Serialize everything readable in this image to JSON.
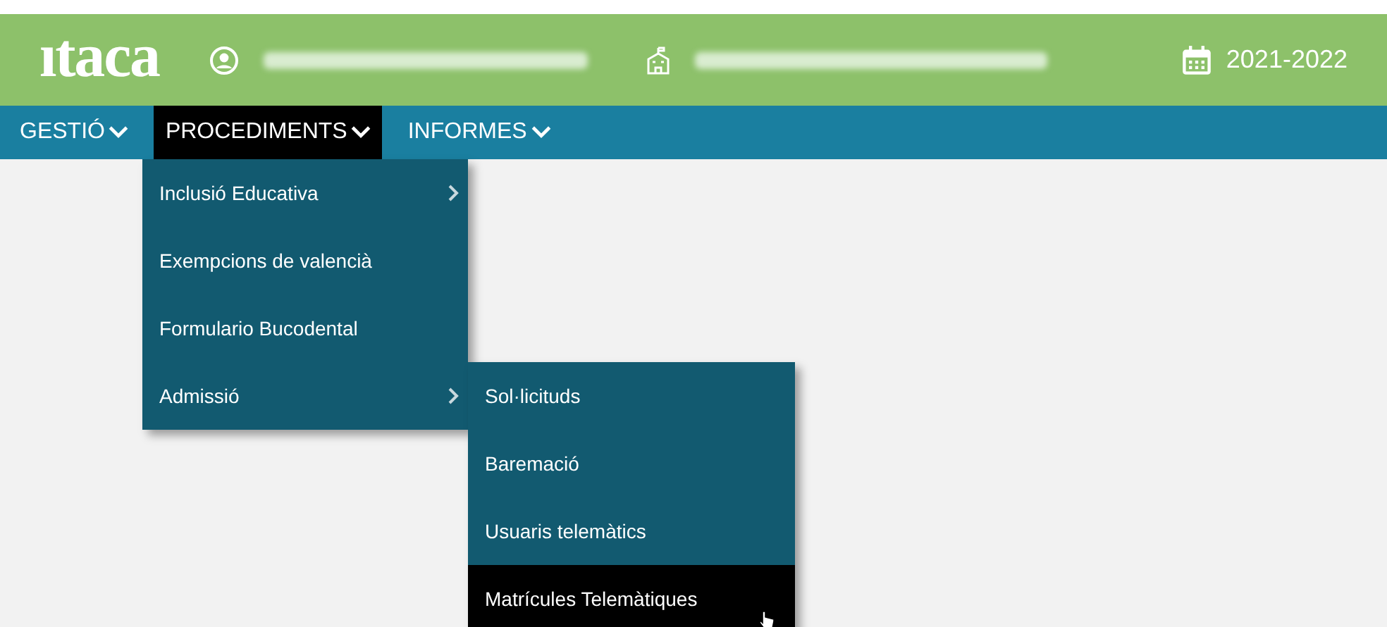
{
  "header": {
    "logo": "ıtaca",
    "year": "2021-2022"
  },
  "nav": [
    {
      "label": "GESTIÓ",
      "selected": false
    },
    {
      "label": "PROCEDIMENTS",
      "selected": true
    },
    {
      "label": "INFORMES",
      "selected": false
    }
  ],
  "menu": {
    "items": [
      {
        "label": "Inclusió Educativa",
        "has_submenu": true
      },
      {
        "label": "Exempcions de valencià",
        "has_submenu": false
      },
      {
        "label": "Formulario Bucodental",
        "has_submenu": false
      },
      {
        "label": "Admissió",
        "has_submenu": true
      }
    ]
  },
  "submenu": {
    "items": [
      {
        "label": "Sol·licituds",
        "selected": false
      },
      {
        "label": "Baremació",
        "selected": false
      },
      {
        "label": "Usuaris telemàtics",
        "selected": false
      },
      {
        "label": "Matrícules Telemàtiques",
        "selected": true
      }
    ]
  }
}
